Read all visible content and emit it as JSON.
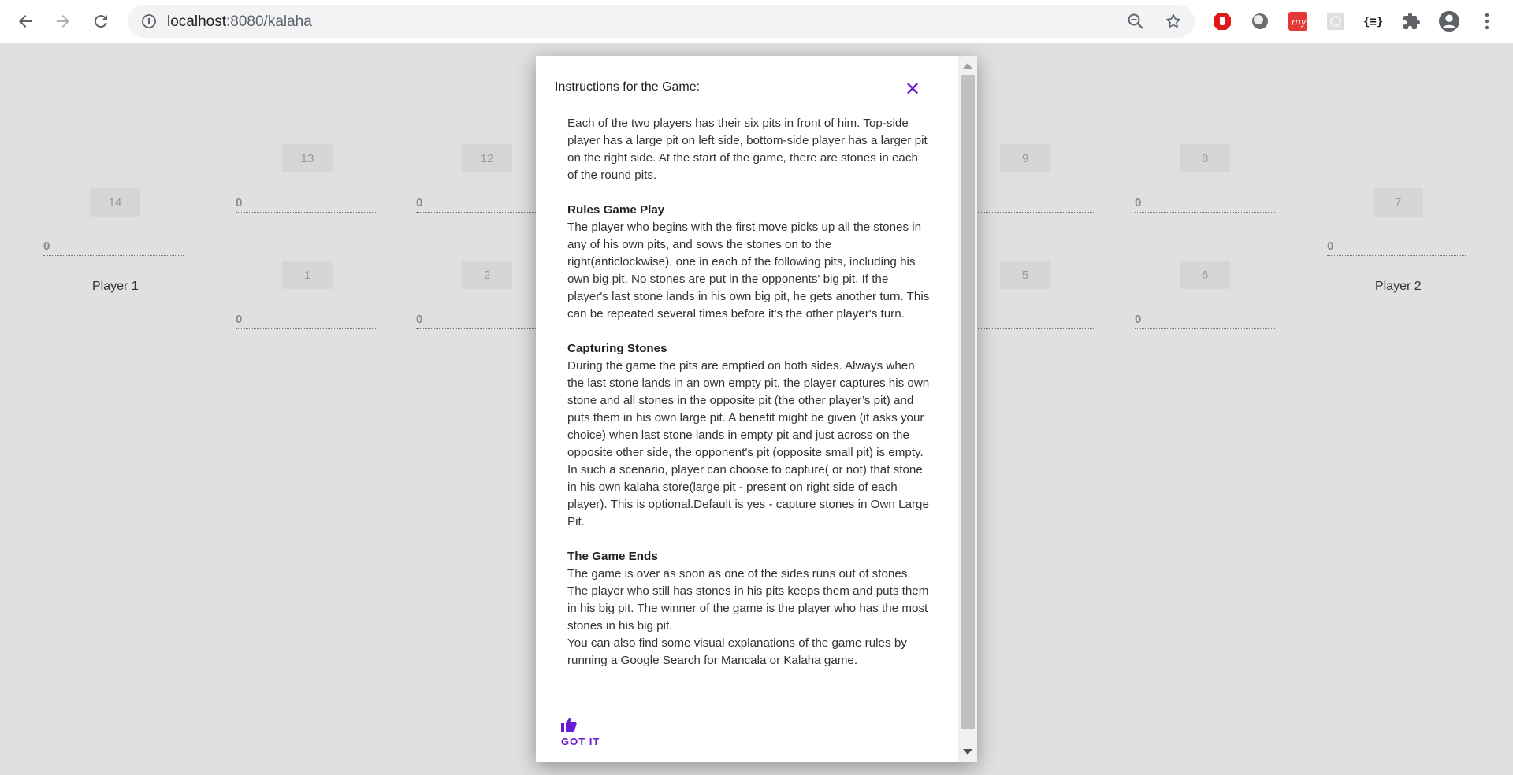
{
  "browser": {
    "url_host": "localhost",
    "url_rest": ":8080/kalaha"
  },
  "board": {
    "top_pits": [
      {
        "label": "13",
        "value": "0"
      },
      {
        "label": "12",
        "value": "0"
      },
      {
        "label": "9",
        "value": "0"
      },
      {
        "label": "8",
        "value": "0"
      }
    ],
    "bottom_pits": [
      {
        "label": "1",
        "value": "0"
      },
      {
        "label": "2",
        "value": "0"
      },
      {
        "label": "5",
        "value": "0"
      },
      {
        "label": "6",
        "value": "0"
      }
    ],
    "left_store": {
      "label": "14",
      "value": "0",
      "player": "Player 1"
    },
    "right_store": {
      "label": "7",
      "value": "0",
      "player": "Player 2"
    }
  },
  "modal": {
    "title": "Instructions for the Game:",
    "close_glyph": "✕",
    "intro": "Each of the two players has their six pits in front of him. Top-side player has a large pit on left side, bottom-side player has a larger pit on the right side. At the start of the game, there are stones in each of the round pits.",
    "sections": [
      {
        "heading": "Rules Game Play",
        "text": "The player who begins with the first move picks up all the stones in any of his own pits, and sows the stones on to the right(anticlockwise), one in each of the following pits, including his own big pit. No stones are put in the opponents' big pit. If the player's last stone lands in his own big pit, he gets another turn. This can be repeated several times before it's the other player's turn."
      },
      {
        "heading": "Capturing Stones",
        "text": "During the game the pits are emptied on both sides. Always when the last stone lands in an own empty pit, the player captures his own stone and all stones in the opposite pit (the other player’s pit) and puts them in his own large pit. A benefit might be given (it asks your choice) when last stone lands in empty pit and just across on the opposite other side, the opponent's pit (opposite small pit) is empty. In such a scenario, player can choose to capture( or not) that stone in his own kalaha store(large pit - present on right side of each player). This is optional.Default is yes - capture stones in Own Large Pit."
      },
      {
        "heading": "The Game Ends",
        "text": "The game is over as soon as one of the sides runs out of stones. The player who still has stones in his pits keeps them and puts them in his big pit. The winner of the game is the player who has the most stones in his big pit.",
        "extra": "You can also find some visual explanations of the game rules by running a Google Search for Mancala or Kalaha game."
      }
    ],
    "confirm_label": "GOT IT"
  },
  "colors": {
    "accent": "#6a1bd6",
    "overlay_bg": "#e0e0e0",
    "pit_label_bg": "#d6d6d6"
  },
  "icons": [
    "back-arrow-icon",
    "forward-arrow-icon",
    "reload-icon",
    "info-icon",
    "zoom-out-icon",
    "star-icon",
    "extension-red-hand-icon",
    "extension-orb-icon",
    "extension-myapp-icon",
    "extension-grid-icon",
    "extension-braces-icon",
    "puzzle-icon",
    "profile-avatar-icon",
    "kebab-menu-icon",
    "thumbs-up-icon",
    "close-icon"
  ]
}
